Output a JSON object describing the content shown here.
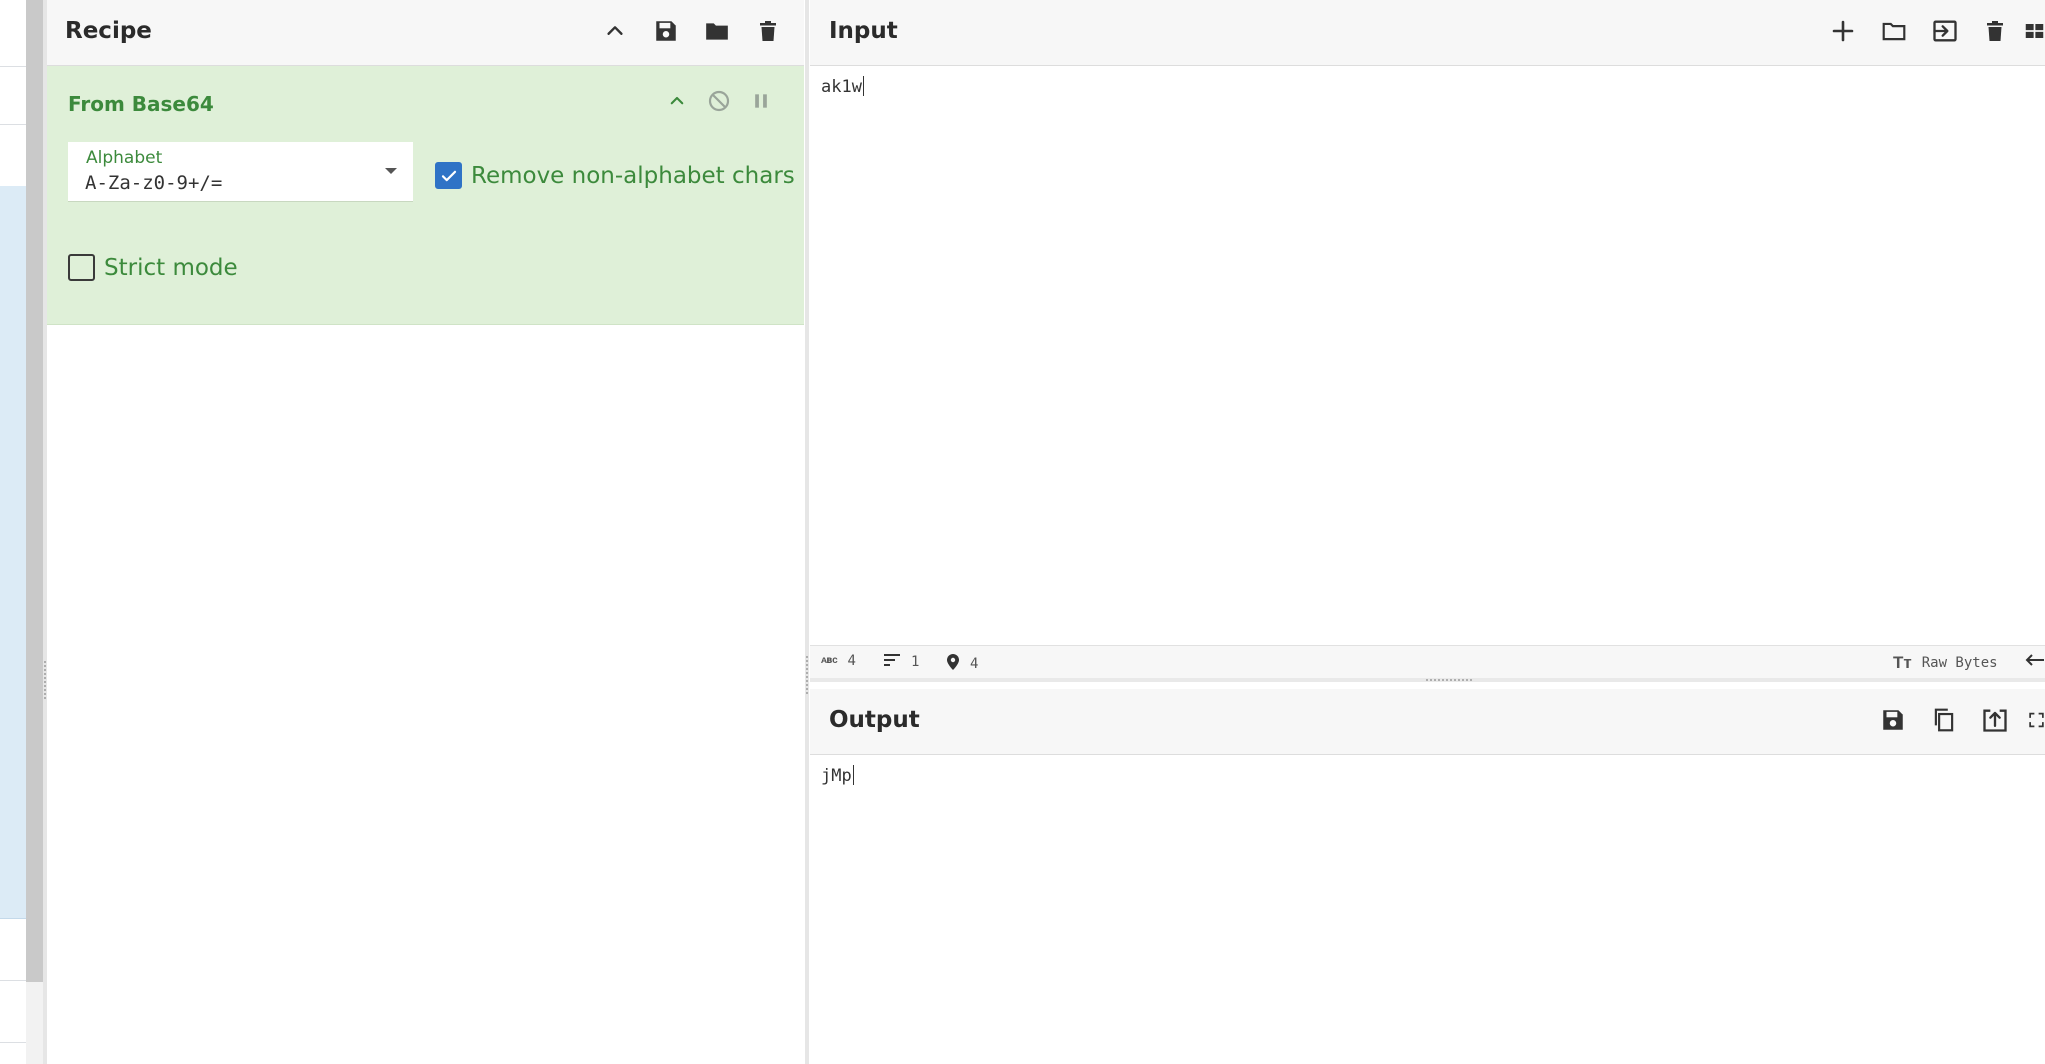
{
  "recipe": {
    "title": "Recipe",
    "operation": {
      "name": "From Base64",
      "alphabet_label": "Alphabet",
      "alphabet_value": "A-Za-z0-9+/=",
      "remove_non_alphabet_label": "Remove non-alphabet chars",
      "remove_non_alphabet_checked": true,
      "strict_mode_label": "Strict mode",
      "strict_mode_checked": false
    }
  },
  "input": {
    "title": "Input",
    "text": "ak1w",
    "status": {
      "chars": "4",
      "lines": "1",
      "position": "4",
      "encoding": "Raw Bytes"
    }
  },
  "output": {
    "title": "Output",
    "text": "jMp"
  },
  "icons": {
    "recipe_header": [
      "chevron-up-icon",
      "save-icon",
      "folder-icon",
      "trash-icon"
    ],
    "operation": [
      "chevron-up-icon",
      "disable-icon",
      "pause-icon"
    ],
    "input_header": [
      "plus-icon",
      "folder-icon",
      "import-icon",
      "trash-icon",
      "layout-icon"
    ],
    "output_header": [
      "save-icon",
      "copy-icon",
      "replace-input-icon",
      "maximize-icon"
    ]
  },
  "colors": {
    "operation_bg": "#dff0d8",
    "operation_text": "#3c8a3c",
    "checkbox_checked": "#2f73c6",
    "header_bg": "#f7f7f7"
  }
}
